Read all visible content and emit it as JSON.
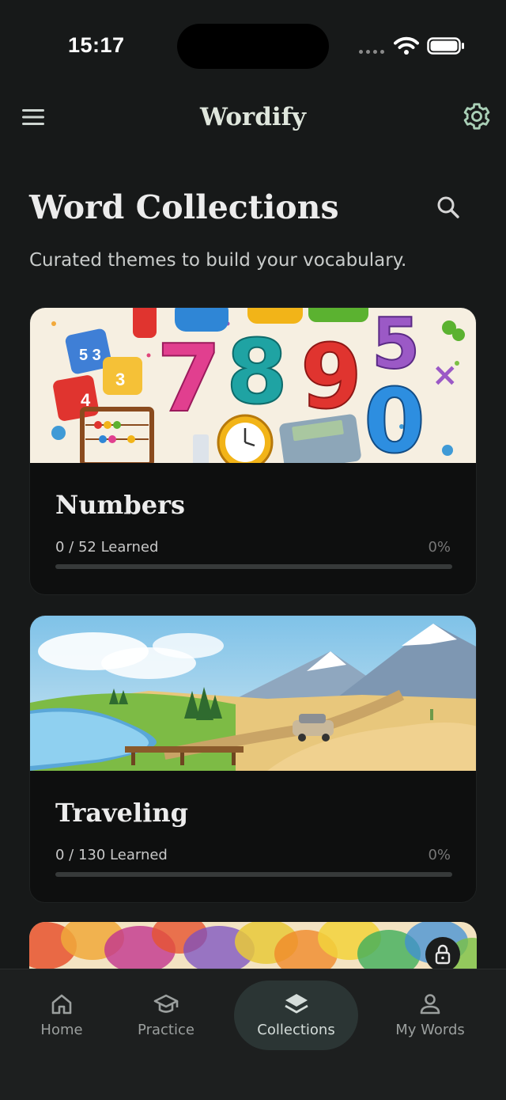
{
  "status_bar": {
    "time": "15:17"
  },
  "header": {
    "title": "Wordify"
  },
  "page": {
    "title": "Word Collections",
    "subtitle": "Curated themes to build your vocabulary."
  },
  "collections": [
    {
      "title": "Numbers",
      "progress": "0 / 52 Learned",
      "percent": "0%",
      "progress_fraction": 0
    },
    {
      "title": "Traveling",
      "progress": "0 / 130 Learned",
      "percent": "0%",
      "progress_fraction": 0
    }
  ],
  "peek_card": {
    "locked": true
  },
  "bottom_nav": {
    "items": [
      {
        "label": "Home",
        "icon": "home-icon"
      },
      {
        "label": "Practice",
        "icon": "graduation-cap-icon"
      },
      {
        "label": "Collections",
        "icon": "layers-icon",
        "active": true
      },
      {
        "label": "My Words",
        "icon": "person-icon"
      }
    ]
  },
  "colors": {
    "background": "#171919",
    "card_background": "#0e0f0f",
    "nav_active": "#2b3534",
    "title_text": "#dfe6dc"
  }
}
